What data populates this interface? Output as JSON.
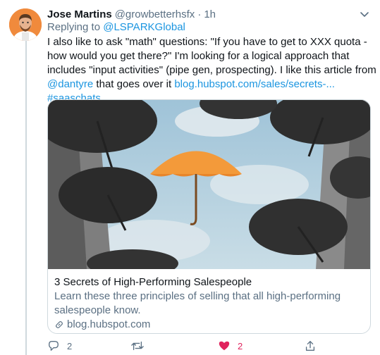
{
  "tweet": {
    "author_name": "Jose Martins",
    "author_handle": "@growbetterhsfx",
    "separator": "·",
    "time": "1h",
    "reply_prefix": "Replying to",
    "reply_to": "@LSPARKGlobal",
    "body": {
      "line1": "I also like to ask \"math\" questions: \"If you have to get to XXX quota -",
      "line2": "how would you get there?\" I'm looking for a logical approach that",
      "line3": "includes \"input activities\" (pipe gen, prospecting). I like this article from",
      "mention": "@dantyre",
      "line4_mid": " that goes over it ",
      "link": "blog.hubspot.com/sales/secrets-...",
      "hashtag": "#saaschats"
    },
    "card": {
      "title": "3 Secrets of High-Performing Salespeople",
      "description": "Learn these three principles of selling that all high-performing salespeople know.",
      "domain": "blog.hubspot.com"
    },
    "actions": {
      "reply_count": "2",
      "retweet_count": "",
      "like_count": "2"
    }
  },
  "colors": {
    "accent": "#1b95e0",
    "secondary_text": "#5b7083",
    "like": "#e0245e",
    "umbrella_orange": "#f39a3a"
  },
  "icons": [
    "chevron-down-icon",
    "reply-icon",
    "retweet-icon",
    "heart-icon",
    "share-icon",
    "link-icon"
  ]
}
